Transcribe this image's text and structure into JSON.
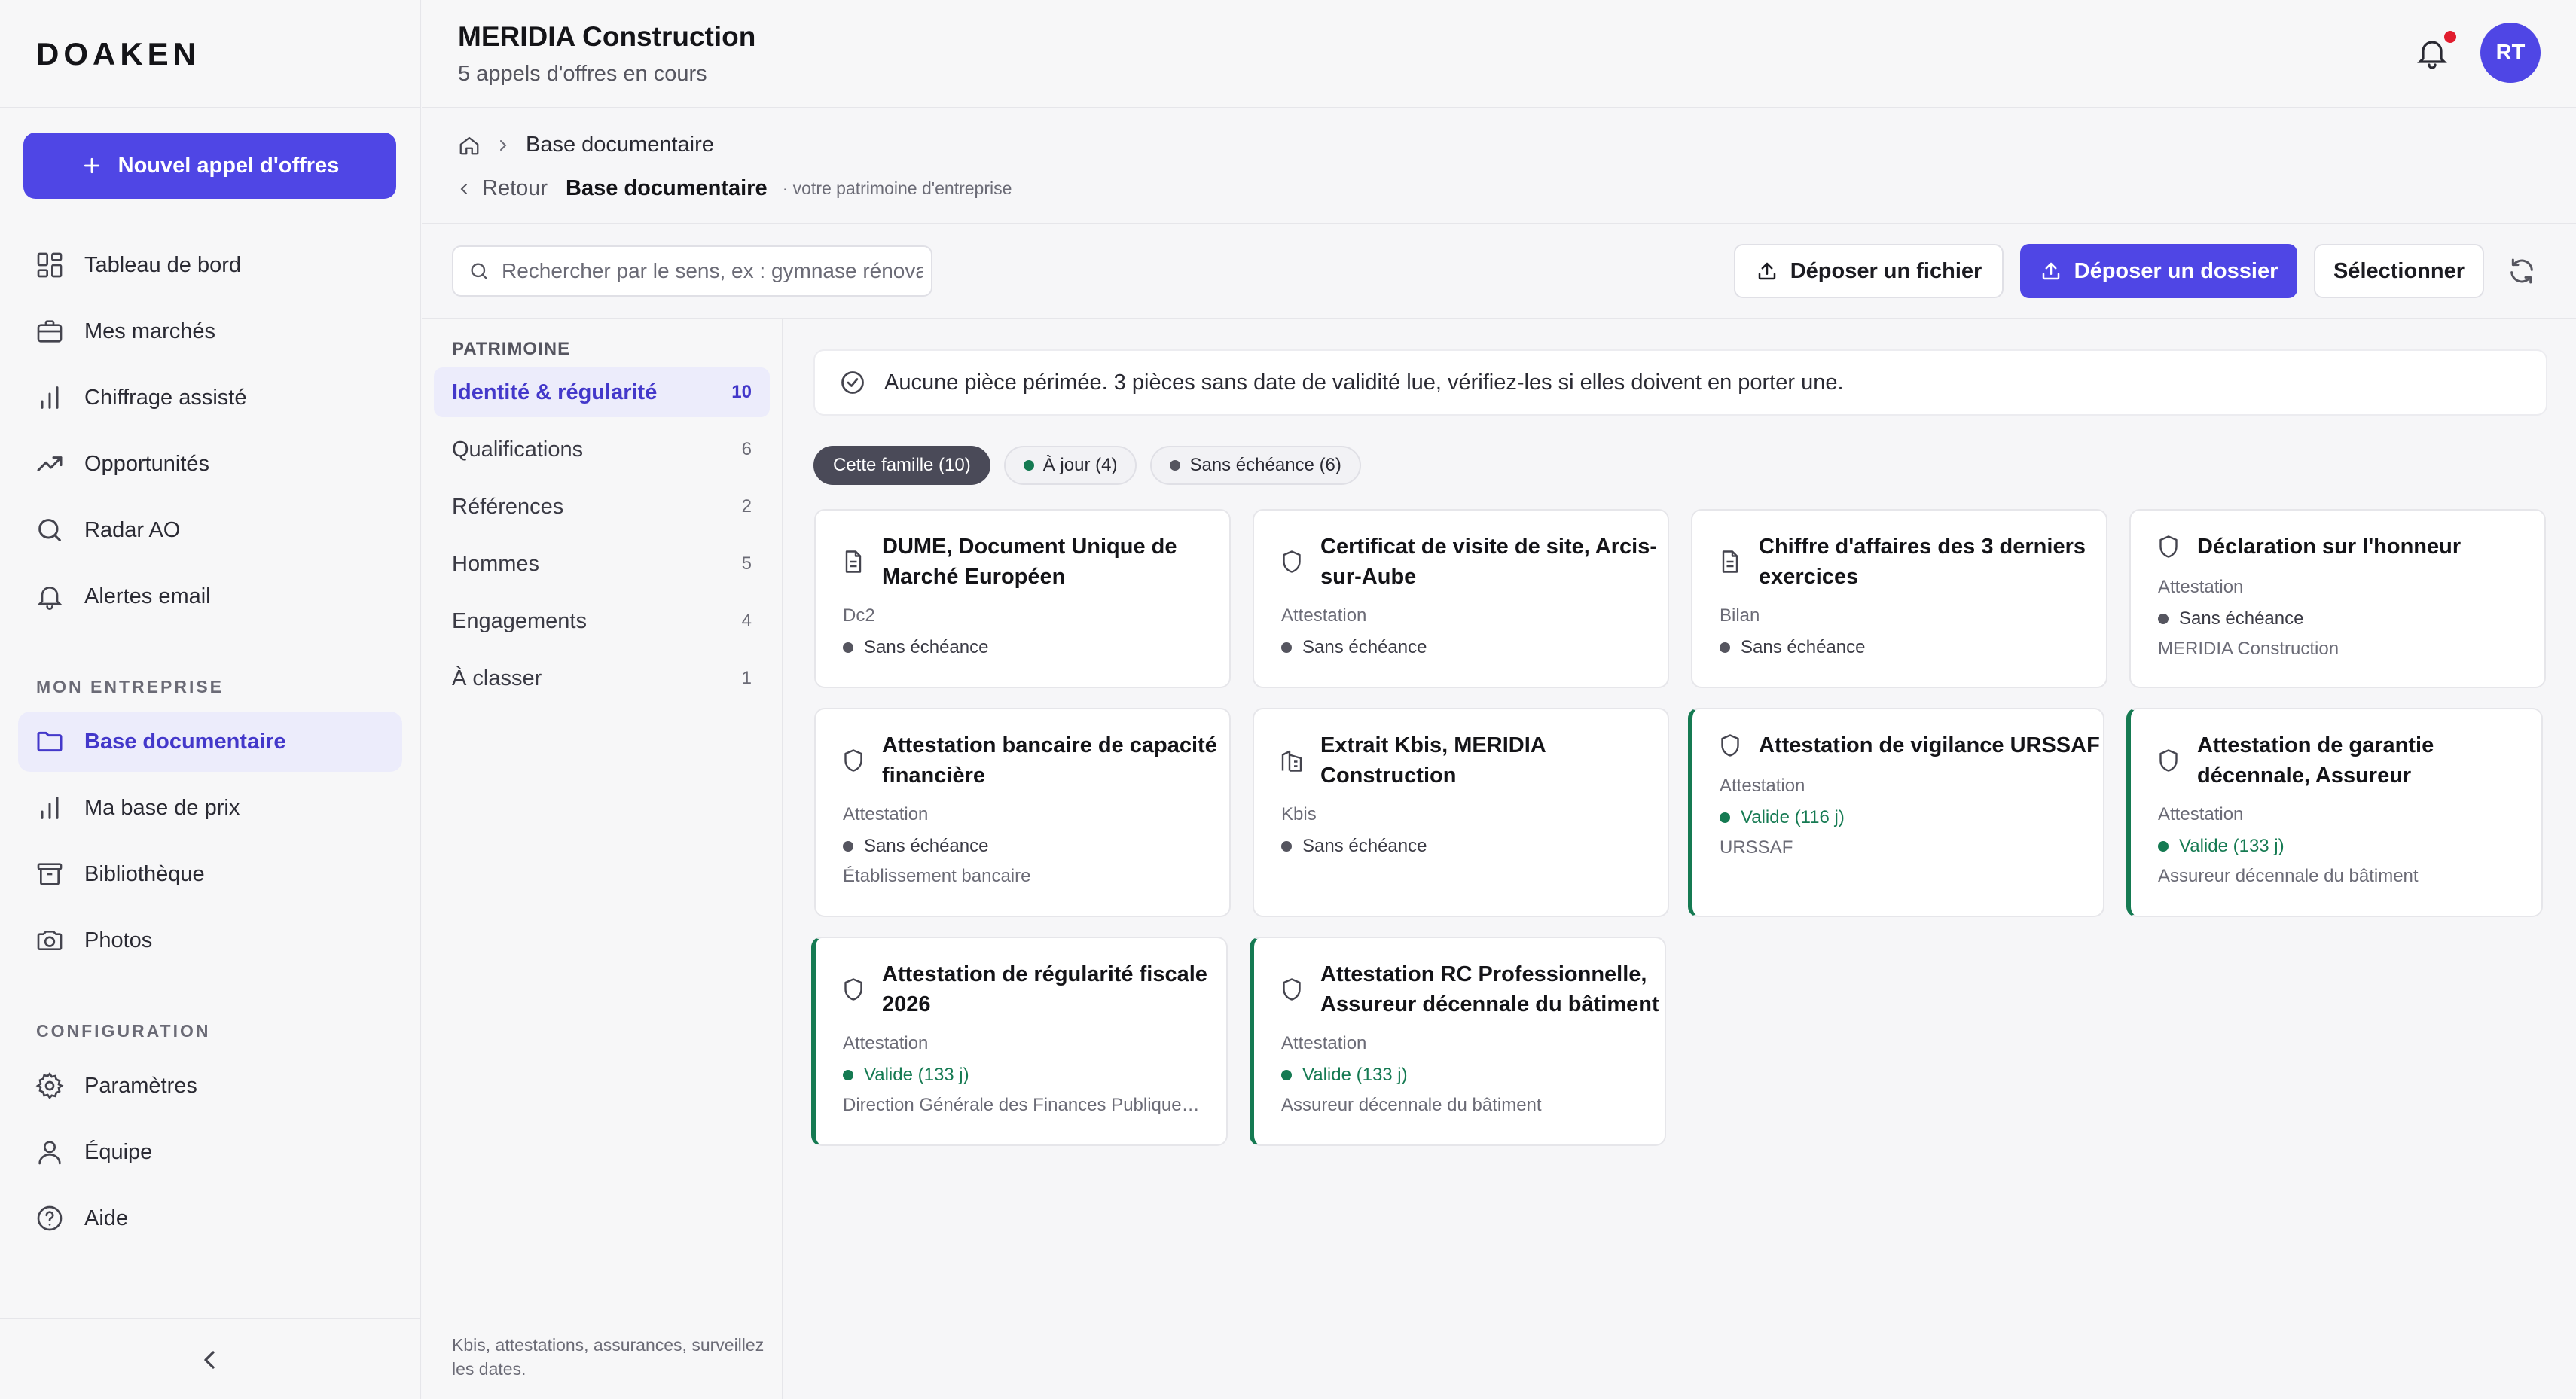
{
  "app": {
    "logo": "DOAKEN"
  },
  "sidebar": {
    "new_button": "Nouvel appel d'offres",
    "items": [
      {
        "label": "Tableau de bord",
        "icon": "dashboard-icon"
      },
      {
        "label": "Mes marchés",
        "icon": "briefcase-icon"
      },
      {
        "label": "Chiffrage assisté",
        "icon": "bar-chart-icon"
      },
      {
        "label": "Opportunités",
        "icon": "trending-up-icon"
      },
      {
        "label": "Radar AO",
        "icon": "search-icon"
      },
      {
        "label": "Alertes email",
        "icon": "bell-icon"
      }
    ],
    "section_company": "MON ENTREPRISE",
    "company_items": [
      {
        "label": "Base documentaire",
        "icon": "folder-icon",
        "active": true
      },
      {
        "label": "Ma base de prix",
        "icon": "bar-chart-icon"
      },
      {
        "label": "Bibliothèque",
        "icon": "archive-icon"
      },
      {
        "label": "Photos",
        "icon": "camera-icon"
      }
    ],
    "section_config": "CONFIGURATION",
    "config_items": [
      {
        "label": "Paramètres",
        "icon": "gear-icon"
      },
      {
        "label": "Équipe",
        "icon": "user-icon"
      },
      {
        "label": "Aide",
        "icon": "help-icon"
      }
    ]
  },
  "header": {
    "company": "MERIDIA Construction",
    "subtitle": "5 appels d'offres en cours",
    "avatar": "RT",
    "accent": "#4f46e5"
  },
  "breadcrumb": {
    "current": "Base documentaire"
  },
  "page": {
    "back": "Retour",
    "title": "Base documentaire",
    "subtitle": "· votre patrimoine d'entreprise"
  },
  "toolbar": {
    "search_placeholder": "Rechercher par le sens, ex : gymnase rénovation",
    "upload_file": "Déposer un fichier",
    "upload_folder": "Déposer un dossier",
    "select": "Sélectionner"
  },
  "categories": {
    "title": "PATRIMOINE",
    "items": [
      {
        "label": "Identité & régularité",
        "count": "10",
        "active": true
      },
      {
        "label": "Qualifications",
        "count": "6"
      },
      {
        "label": "Références",
        "count": "2"
      },
      {
        "label": "Hommes",
        "count": "5"
      },
      {
        "label": "Engagements",
        "count": "4"
      },
      {
        "label": "À classer",
        "count": "1"
      }
    ],
    "footer": "Kbis, attestations, assurances, surveillez les dates."
  },
  "notice": "Aucune pièce périmée. 3 pièces sans date de validité lue, vérifiez-les si elles doivent en porter une.",
  "filters": [
    {
      "label": "Cette famille (10)",
      "active": true
    },
    {
      "label": "À jour (4)",
      "dot": "#157a52"
    },
    {
      "label": "Sans échéance (6)",
      "dot": "#55555f"
    }
  ],
  "status_colors": {
    "valid": "#157a52",
    "none": "#55555f"
  },
  "documents": [
    {
      "title": "DUME, Document Unique de Marché Européen",
      "type": "Dc2",
      "status": "Sans échéance",
      "issuer": "",
      "icon": "document-icon",
      "valid": false
    },
    {
      "title": "Certificat de visite de site, Arcis-sur-Aube",
      "type": "Attestation",
      "status": "Sans échéance",
      "issuer": "",
      "icon": "shield-icon",
      "valid": false
    },
    {
      "title": "Chiffre d'affaires des 3 derniers exercices",
      "type": "Bilan",
      "status": "Sans échéance",
      "issuer": "",
      "icon": "document-icon",
      "valid": false
    },
    {
      "title": "Déclaration sur l'honneur",
      "type": "Attestation",
      "status": "Sans échéance",
      "issuer": "MERIDIA Construction",
      "icon": "shield-icon",
      "valid": false
    },
    {
      "title": "Attestation bancaire de capacité financière",
      "type": "Attestation",
      "status": "Sans échéance",
      "issuer": "Établissement bancaire",
      "icon": "shield-icon",
      "valid": false
    },
    {
      "title": "Extrait Kbis, MERIDIA Construction",
      "type": "Kbis",
      "status": "Sans échéance",
      "issuer": "",
      "icon": "building-icon",
      "valid": false
    },
    {
      "title": "Attestation de vigilance URSSAF",
      "type": "Attestation",
      "status": "Valide (116 j)",
      "issuer": "URSSAF",
      "icon": "shield-icon",
      "valid": true
    },
    {
      "title": "Attestation de garantie décennale, Assureur décennale…",
      "type": "Attestation",
      "status": "Valide (133 j)",
      "issuer": "Assureur décennale du bâtiment",
      "icon": "shield-icon",
      "valid": true
    },
    {
      "title": "Attestation de régularité fiscale 2026",
      "type": "Attestation",
      "status": "Valide (133 j)",
      "issuer": "Direction Générale des Finances Publique…",
      "icon": "shield-icon",
      "valid": true
    },
    {
      "title": "Attestation RC Professionnelle, Assureur décennale du bâtiment",
      "type": "Attestation",
      "status": "Valide (133 j)",
      "issuer": "Assureur décennale du bâtiment",
      "icon": "shield-icon",
      "valid": true
    }
  ]
}
